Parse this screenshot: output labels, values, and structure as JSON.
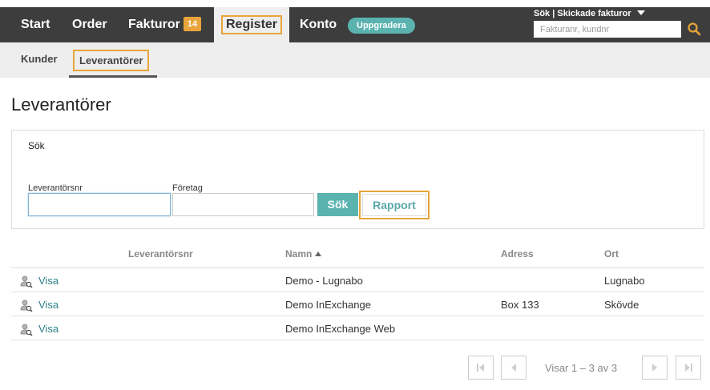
{
  "topnav": {
    "start": "Start",
    "order": "Order",
    "fakturor": "Fakturor",
    "fakturor_count": "14",
    "register": "Register",
    "konto": "Konto",
    "upgrade": "Uppgradera",
    "search_mode": "Sök | Skickade fakturor",
    "search_placeholder": "Fakturanr, kundnr"
  },
  "subnav": {
    "kunder": "Kunder",
    "leverantorer": "Leverantörer"
  },
  "page": {
    "title": "Leverantörer"
  },
  "search_panel": {
    "title": "Sök",
    "levnr_label": "Leverantörsnr",
    "foretag_label": "Företag",
    "levnr_value": "",
    "foretag_value": "",
    "search_button": "Sök",
    "report_button": "Rapport"
  },
  "table": {
    "columns": {
      "levnr": "Leverantörsnr",
      "namn": "Namn",
      "adress": "Adress",
      "ort": "Ort"
    },
    "rows": [
      {
        "visa": "Visa",
        "namn": "Demo - Lugnabo",
        "adress": "",
        "ort": "Lugnabo"
      },
      {
        "visa": "Visa",
        "namn": "Demo InExchange",
        "adress": "Box 133",
        "ort": "Skövde"
      },
      {
        "visa": "Visa",
        "namn": "Demo InExchange Web",
        "adress": "",
        "ort": ""
      }
    ]
  },
  "pagination": {
    "text": "Visar 1 – 3 av 3"
  },
  "colors": {
    "accent": "#e8a43a",
    "teal": "#5bb3b0",
    "topbar": "#3d3d3d"
  }
}
